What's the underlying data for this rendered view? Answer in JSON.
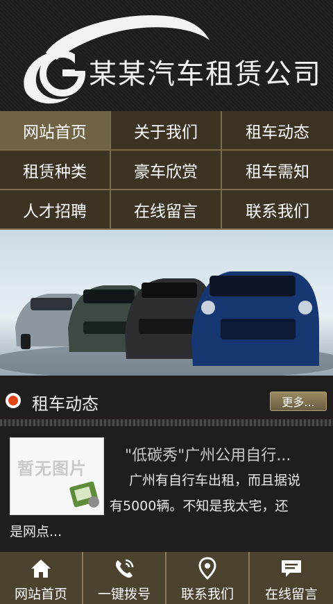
{
  "header": {
    "company_name": "某某汽车租赁公司"
  },
  "nav": {
    "items": [
      {
        "label": "网站首页",
        "active": true
      },
      {
        "label": "关于我们"
      },
      {
        "label": "租车动态"
      },
      {
        "label": "租赁种类"
      },
      {
        "label": "豪车欣赏"
      },
      {
        "label": "租车需知"
      },
      {
        "label": "人才招聘"
      },
      {
        "label": "在线留言"
      },
      {
        "label": "联系我们"
      }
    ]
  },
  "section": {
    "title": "租车动态",
    "more_label": "更多..."
  },
  "news": {
    "thumb_text": "暂无图片",
    "title": "\"低碳秀\"广州公用自行...",
    "body_line1": "广州有自行车出租，而且据说",
    "body_line2": "有5000辆。不知是我太宅，还",
    "body_line3": "是网点..."
  },
  "bottom": {
    "items": [
      {
        "label": "网站首页",
        "icon": "home-icon"
      },
      {
        "label": "一键拨号",
        "icon": "phone-icon"
      },
      {
        "label": "联系我们",
        "icon": "map-pin-icon"
      },
      {
        "label": "在线留言",
        "icon": "message-icon"
      }
    ]
  },
  "colors": {
    "accent_dot": "#e04316",
    "nav_active": "#6f6245",
    "nav_bg": "#3c3322"
  }
}
